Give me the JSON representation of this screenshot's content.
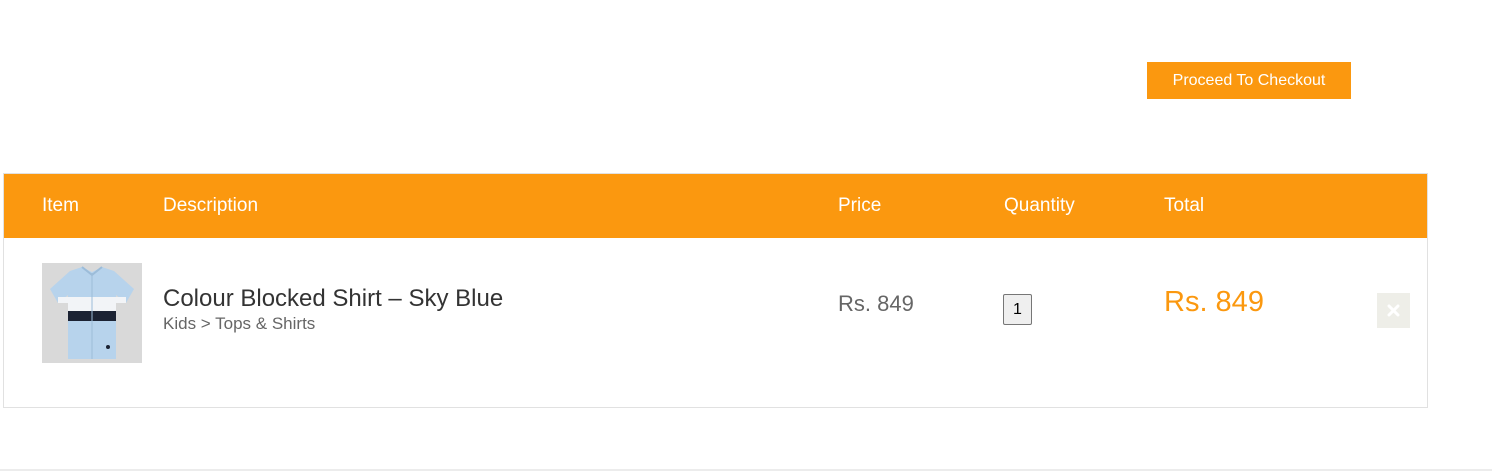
{
  "checkout": {
    "label": "Proceed To Checkout"
  },
  "table": {
    "headers": {
      "item": "Item",
      "description": "Description",
      "price": "Price",
      "quantity": "Quantity",
      "total": "Total"
    },
    "rows": [
      {
        "name": "Colour Blocked Shirt – Sky Blue",
        "category": "Kids > Tops & Shirts",
        "price": "Rs. 849",
        "quantity": "1",
        "total": "Rs. 849",
        "image_icon": "shirt-icon",
        "remove_icon": "close-icon"
      }
    ]
  },
  "colors": {
    "accent": "#fb980f",
    "header_text": "#ffffff",
    "remove_bg": "#eeeee8"
  }
}
